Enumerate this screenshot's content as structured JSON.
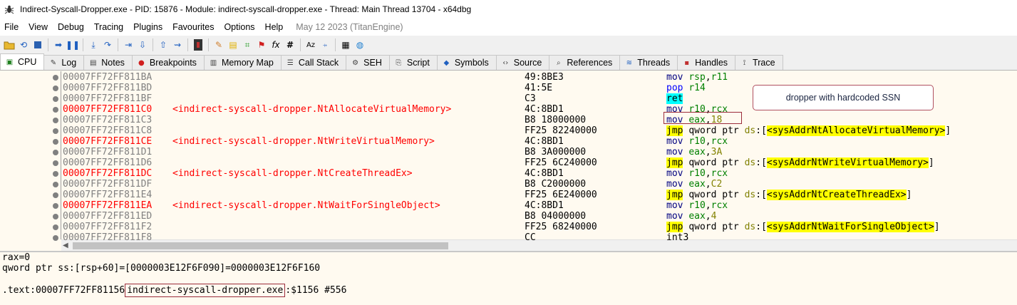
{
  "window": {
    "title": "Indirect-Syscall-Dropper.exe - PID: 15876 - Module: indirect-syscall-dropper.exe - Thread: Main Thread 13704 - x64dbg"
  },
  "menu": {
    "items": [
      "File",
      "View",
      "Debug",
      "Tracing",
      "Plugins",
      "Favourites",
      "Options",
      "Help"
    ],
    "date": "May 12 2023 (TitanEngine)"
  },
  "tabs": [
    {
      "label": "CPU",
      "icon": "cpu-icon"
    },
    {
      "label": "Log",
      "icon": "log-icon"
    },
    {
      "label": "Notes",
      "icon": "notes-icon"
    },
    {
      "label": "Breakpoints",
      "icon": "breakpoint-icon"
    },
    {
      "label": "Memory Map",
      "icon": "memory-map-icon"
    },
    {
      "label": "Call Stack",
      "icon": "call-stack-icon"
    },
    {
      "label": "SEH",
      "icon": "seh-icon"
    },
    {
      "label": "Script",
      "icon": "script-icon"
    },
    {
      "label": "Symbols",
      "icon": "symbols-icon"
    },
    {
      "label": "Source",
      "icon": "source-icon"
    },
    {
      "label": "References",
      "icon": "references-icon"
    },
    {
      "label": "Threads",
      "icon": "threads-icon"
    },
    {
      "label": "Handles",
      "icon": "handles-icon"
    },
    {
      "label": "Trace",
      "icon": "trace-icon"
    }
  ],
  "disasm": {
    "rows": [
      {
        "addr": "00007FF72FF811BA",
        "label": "",
        "bytes": "49:8BE3",
        "mnem": "mov",
        "ops": [
          [
            "reg",
            "rsp"
          ],
          [
            "t",
            ","
          ],
          [
            "reg",
            "r11"
          ]
        ]
      },
      {
        "addr": "00007FF72FF811BD",
        "label": "",
        "bytes": "41:5E",
        "mnem": "pop",
        "ops": [
          [
            "reg",
            "r14"
          ]
        ]
      },
      {
        "addr": "00007FF72FF811BF",
        "label": "",
        "bytes": "C3",
        "mnem": "ret",
        "ops": []
      },
      {
        "addr": "00007FF72FF811C0",
        "label": "<indirect-syscall-dropper.NtAllocateVirtualMemory>",
        "bytes": "4C:8BD1",
        "mnem": "mov",
        "ops": [
          [
            "reg",
            "r10"
          ],
          [
            "t",
            ","
          ],
          [
            "reg",
            "rcx"
          ]
        ]
      },
      {
        "addr": "00007FF72FF811C3",
        "label": "",
        "bytes": "B8 18000000",
        "mnem": "mov",
        "ops": [
          [
            "reg",
            "eax"
          ],
          [
            "t",
            ","
          ],
          [
            "num",
            "18"
          ]
        ]
      },
      {
        "addr": "00007FF72FF811C8",
        "label": "",
        "bytes": "FF25 82240000",
        "mnem": "jmp",
        "ops": [
          [
            "t",
            "qword ptr "
          ],
          [
            "seg",
            "ds"
          ],
          [
            "t",
            ":["
          ],
          [
            "sym",
            "<sysAddrNtAllocateVirtualMemory>"
          ],
          [
            "t",
            "]"
          ]
        ]
      },
      {
        "addr": "00007FF72FF811CE",
        "label": "<indirect-syscall-dropper.NtWriteVirtualMemory>",
        "bytes": "4C:8BD1",
        "mnem": "mov",
        "ops": [
          [
            "reg",
            "r10"
          ],
          [
            "t",
            ","
          ],
          [
            "reg",
            "rcx"
          ]
        ]
      },
      {
        "addr": "00007FF72FF811D1",
        "label": "",
        "bytes": "B8 3A000000",
        "mnem": "mov",
        "ops": [
          [
            "reg",
            "eax"
          ],
          [
            "t",
            ","
          ],
          [
            "num",
            "3A"
          ]
        ]
      },
      {
        "addr": "00007FF72FF811D6",
        "label": "",
        "bytes": "FF25 6C240000",
        "mnem": "jmp",
        "ops": [
          [
            "t",
            "qword ptr "
          ],
          [
            "seg",
            "ds"
          ],
          [
            "t",
            ":["
          ],
          [
            "sym",
            "<sysAddrNtWriteVirtualMemory>"
          ],
          [
            "t",
            "]"
          ]
        ]
      },
      {
        "addr": "00007FF72FF811DC",
        "label": "<indirect-syscall-dropper.NtCreateThreadEx>",
        "bytes": "4C:8BD1",
        "mnem": "mov",
        "ops": [
          [
            "reg",
            "r10"
          ],
          [
            "t",
            ","
          ],
          [
            "reg",
            "rcx"
          ]
        ]
      },
      {
        "addr": "00007FF72FF811DF",
        "label": "",
        "bytes": "B8 C2000000",
        "mnem": "mov",
        "ops": [
          [
            "reg",
            "eax"
          ],
          [
            "t",
            ","
          ],
          [
            "num",
            "C2"
          ]
        ]
      },
      {
        "addr": "00007FF72FF811E4",
        "label": "",
        "bytes": "FF25 6E240000",
        "mnem": "jmp",
        "ops": [
          [
            "t",
            "qword ptr "
          ],
          [
            "seg",
            "ds"
          ],
          [
            "t",
            ":["
          ],
          [
            "sym",
            "<sysAddrNtCreateThreadEx>"
          ],
          [
            "t",
            "]"
          ]
        ]
      },
      {
        "addr": "00007FF72FF811EA",
        "label": "<indirect-syscall-dropper.NtWaitForSingleObject>",
        "bytes": "4C:8BD1",
        "mnem": "mov",
        "ops": [
          [
            "reg",
            "r10"
          ],
          [
            "t",
            ","
          ],
          [
            "reg",
            "rcx"
          ]
        ]
      },
      {
        "addr": "00007FF72FF811ED",
        "label": "",
        "bytes": "B8 04000000",
        "mnem": "mov",
        "ops": [
          [
            "reg",
            "eax"
          ],
          [
            "t",
            ","
          ],
          [
            "num",
            "4"
          ]
        ]
      },
      {
        "addr": "00007FF72FF811F2",
        "label": "",
        "bytes": "FF25 68240000",
        "mnem": "jmp",
        "ops": [
          [
            "t",
            "qword ptr "
          ],
          [
            "seg",
            "ds"
          ],
          [
            "t",
            ":["
          ],
          [
            "sym",
            "<sysAddrNtWaitForSingleObject>"
          ],
          [
            "t",
            "]"
          ]
        ]
      },
      {
        "addr": "00007FF72FF811F8",
        "label": "",
        "bytes": "CC",
        "mnem": "int3",
        "ops": []
      }
    ],
    "callout": "dropper with hardcoded SSN"
  },
  "info": {
    "line1": "rax=0",
    "line2": "qword ptr ss:[rsp+60]=[0000003E12F6F090]=0000003E12F6F160",
    "line3_prefix": ".text:00007FF72FF81156",
    "line3_module": "indirect-syscall-dropper.exe",
    "line3_suffix": ":$1156 #556"
  }
}
